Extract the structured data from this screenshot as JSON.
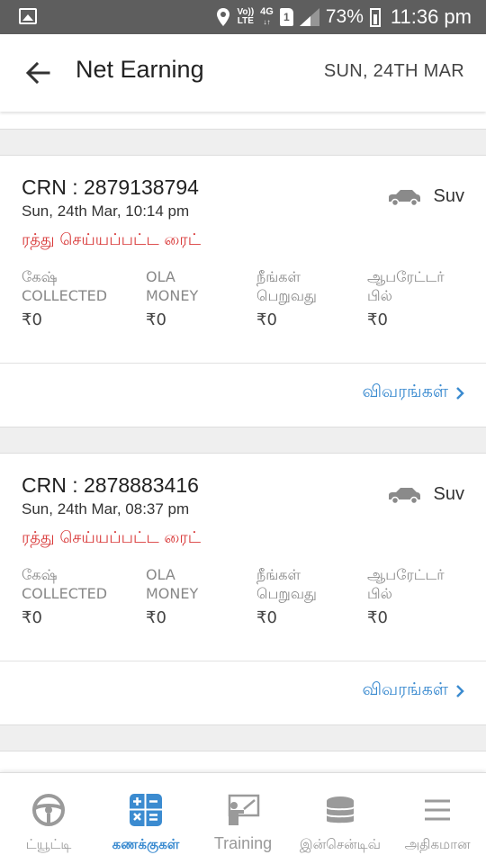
{
  "status_bar": {
    "volte_top": "Vo))",
    "volte_bottom": "LTE",
    "network_label": "4G",
    "network_arrows": "↓↑",
    "sim_number": "1",
    "battery_percent": "73%",
    "time": "11:36 pm"
  },
  "app_bar": {
    "title": "Net Earning",
    "date": "SUN, 24TH MAR"
  },
  "rides": [
    {
      "crn": "CRN : 2879138794",
      "datetime": "Sun, 24th Mar, 10:14 pm",
      "status": "ரத்து செய்யப்பட்ட ரைட்",
      "cab_type": "Suv",
      "stats": [
        {
          "label_line1": "கேஷ்",
          "label_line2": "COLLECTED",
          "value": "₹0"
        },
        {
          "label_line1": "OLA",
          "label_line2": "MONEY",
          "value": "₹0"
        },
        {
          "label_line1": "நீங்கள்",
          "label_line2": "பெறுவது",
          "value": "₹0"
        },
        {
          "label_line1": "ஆபரேட்டர்",
          "label_line2": "பில்",
          "value": "₹0"
        }
      ],
      "details_label": "விவரங்கள்"
    },
    {
      "crn": "CRN : 2878883416",
      "datetime": "Sun, 24th Mar, 08:37 pm",
      "status": "ரத்து செய்யப்பட்ட ரைட்",
      "cab_type": "Suv",
      "stats": [
        {
          "label_line1": "கேஷ்",
          "label_line2": "COLLECTED",
          "value": "₹0"
        },
        {
          "label_line1": "OLA",
          "label_line2": "MONEY",
          "value": "₹0"
        },
        {
          "label_line1": "நீங்கள்",
          "label_line2": "பெறுவது",
          "value": "₹0"
        },
        {
          "label_line1": "ஆபரேட்டர்",
          "label_line2": "பில்",
          "value": "₹0"
        }
      ],
      "details_label": "விவரங்கள்"
    }
  ],
  "bottom_nav": [
    {
      "label": "ட்யூட்டி",
      "icon": "steering-wheel-icon"
    },
    {
      "label": "கணக்குகள்",
      "icon": "calculator-icon",
      "active": true
    },
    {
      "label": "Training",
      "icon": "training-board-icon"
    },
    {
      "label": "இன்சென்டிவ்",
      "icon": "coin-stack-icon"
    },
    {
      "label": "அதிகமான",
      "icon": "menu-icon"
    }
  ],
  "colors": {
    "accent_blue": "#3b8bd0",
    "cancelled_red": "#d93b3b",
    "status_bar_bg": "#5e5e5e",
    "background": "#efefef"
  }
}
